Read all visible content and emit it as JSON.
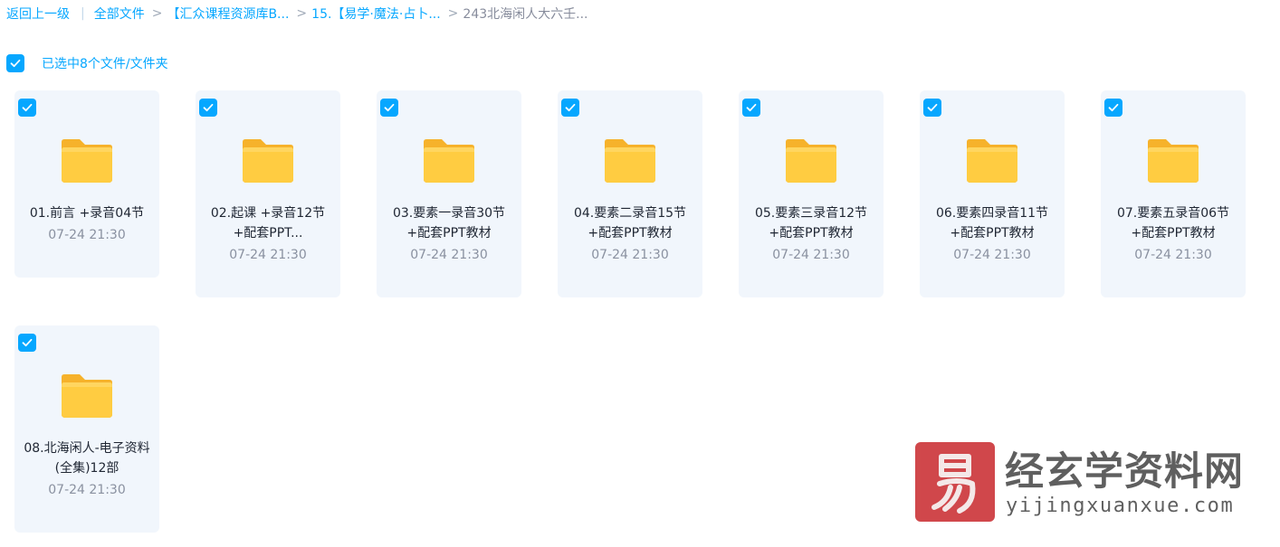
{
  "breadcrumb": {
    "back": "返回上一级",
    "items": [
      {
        "label": "全部文件"
      },
      {
        "label": "【汇众课程资源库B..."
      },
      {
        "label": "15.【易学·魔法·占卜..."
      },
      {
        "label": "243北海闲人大六壬..."
      }
    ],
    "separator": ">"
  },
  "selection": {
    "text": "已选中8个文件/文件夹",
    "checked": true
  },
  "files": [
    {
      "name": "01.前言 +录音04节",
      "time": "07-24 21:30",
      "checked": true
    },
    {
      "name": "02.起课 +录音12节+配套PPT...",
      "time": "07-24 21:30",
      "checked": true
    },
    {
      "name": "03.要素一录音30节+配套PPT教材",
      "time": "07-24 21:30",
      "checked": true
    },
    {
      "name": "04.要素二录音15节+配套PPT教材",
      "time": "07-24 21:30",
      "checked": true
    },
    {
      "name": "05.要素三录音12节+配套PPT教材",
      "time": "07-24 21:30",
      "checked": true
    },
    {
      "name": "06.要素四录音11节+配套PPT教材",
      "time": "07-24 21:30",
      "checked": true
    },
    {
      "name": "07.要素五录音06节+配套PPT教材",
      "time": "07-24 21:30",
      "checked": true
    },
    {
      "name": "08.北海闲人-电子资料(全集)12部",
      "time": "07-24 21:30",
      "checked": true
    }
  ],
  "watermark": {
    "seal_char": "易",
    "title": "经玄学资料网",
    "url": "yijingxuanxue.com"
  },
  "colors": {
    "accent": "#06a7ff",
    "card_bg": "#f1f6fc",
    "folder": "#ffc83d",
    "seal": "#c8282c"
  },
  "icons": {
    "checkbox": "checkmark-icon",
    "folder": "folder-icon"
  }
}
